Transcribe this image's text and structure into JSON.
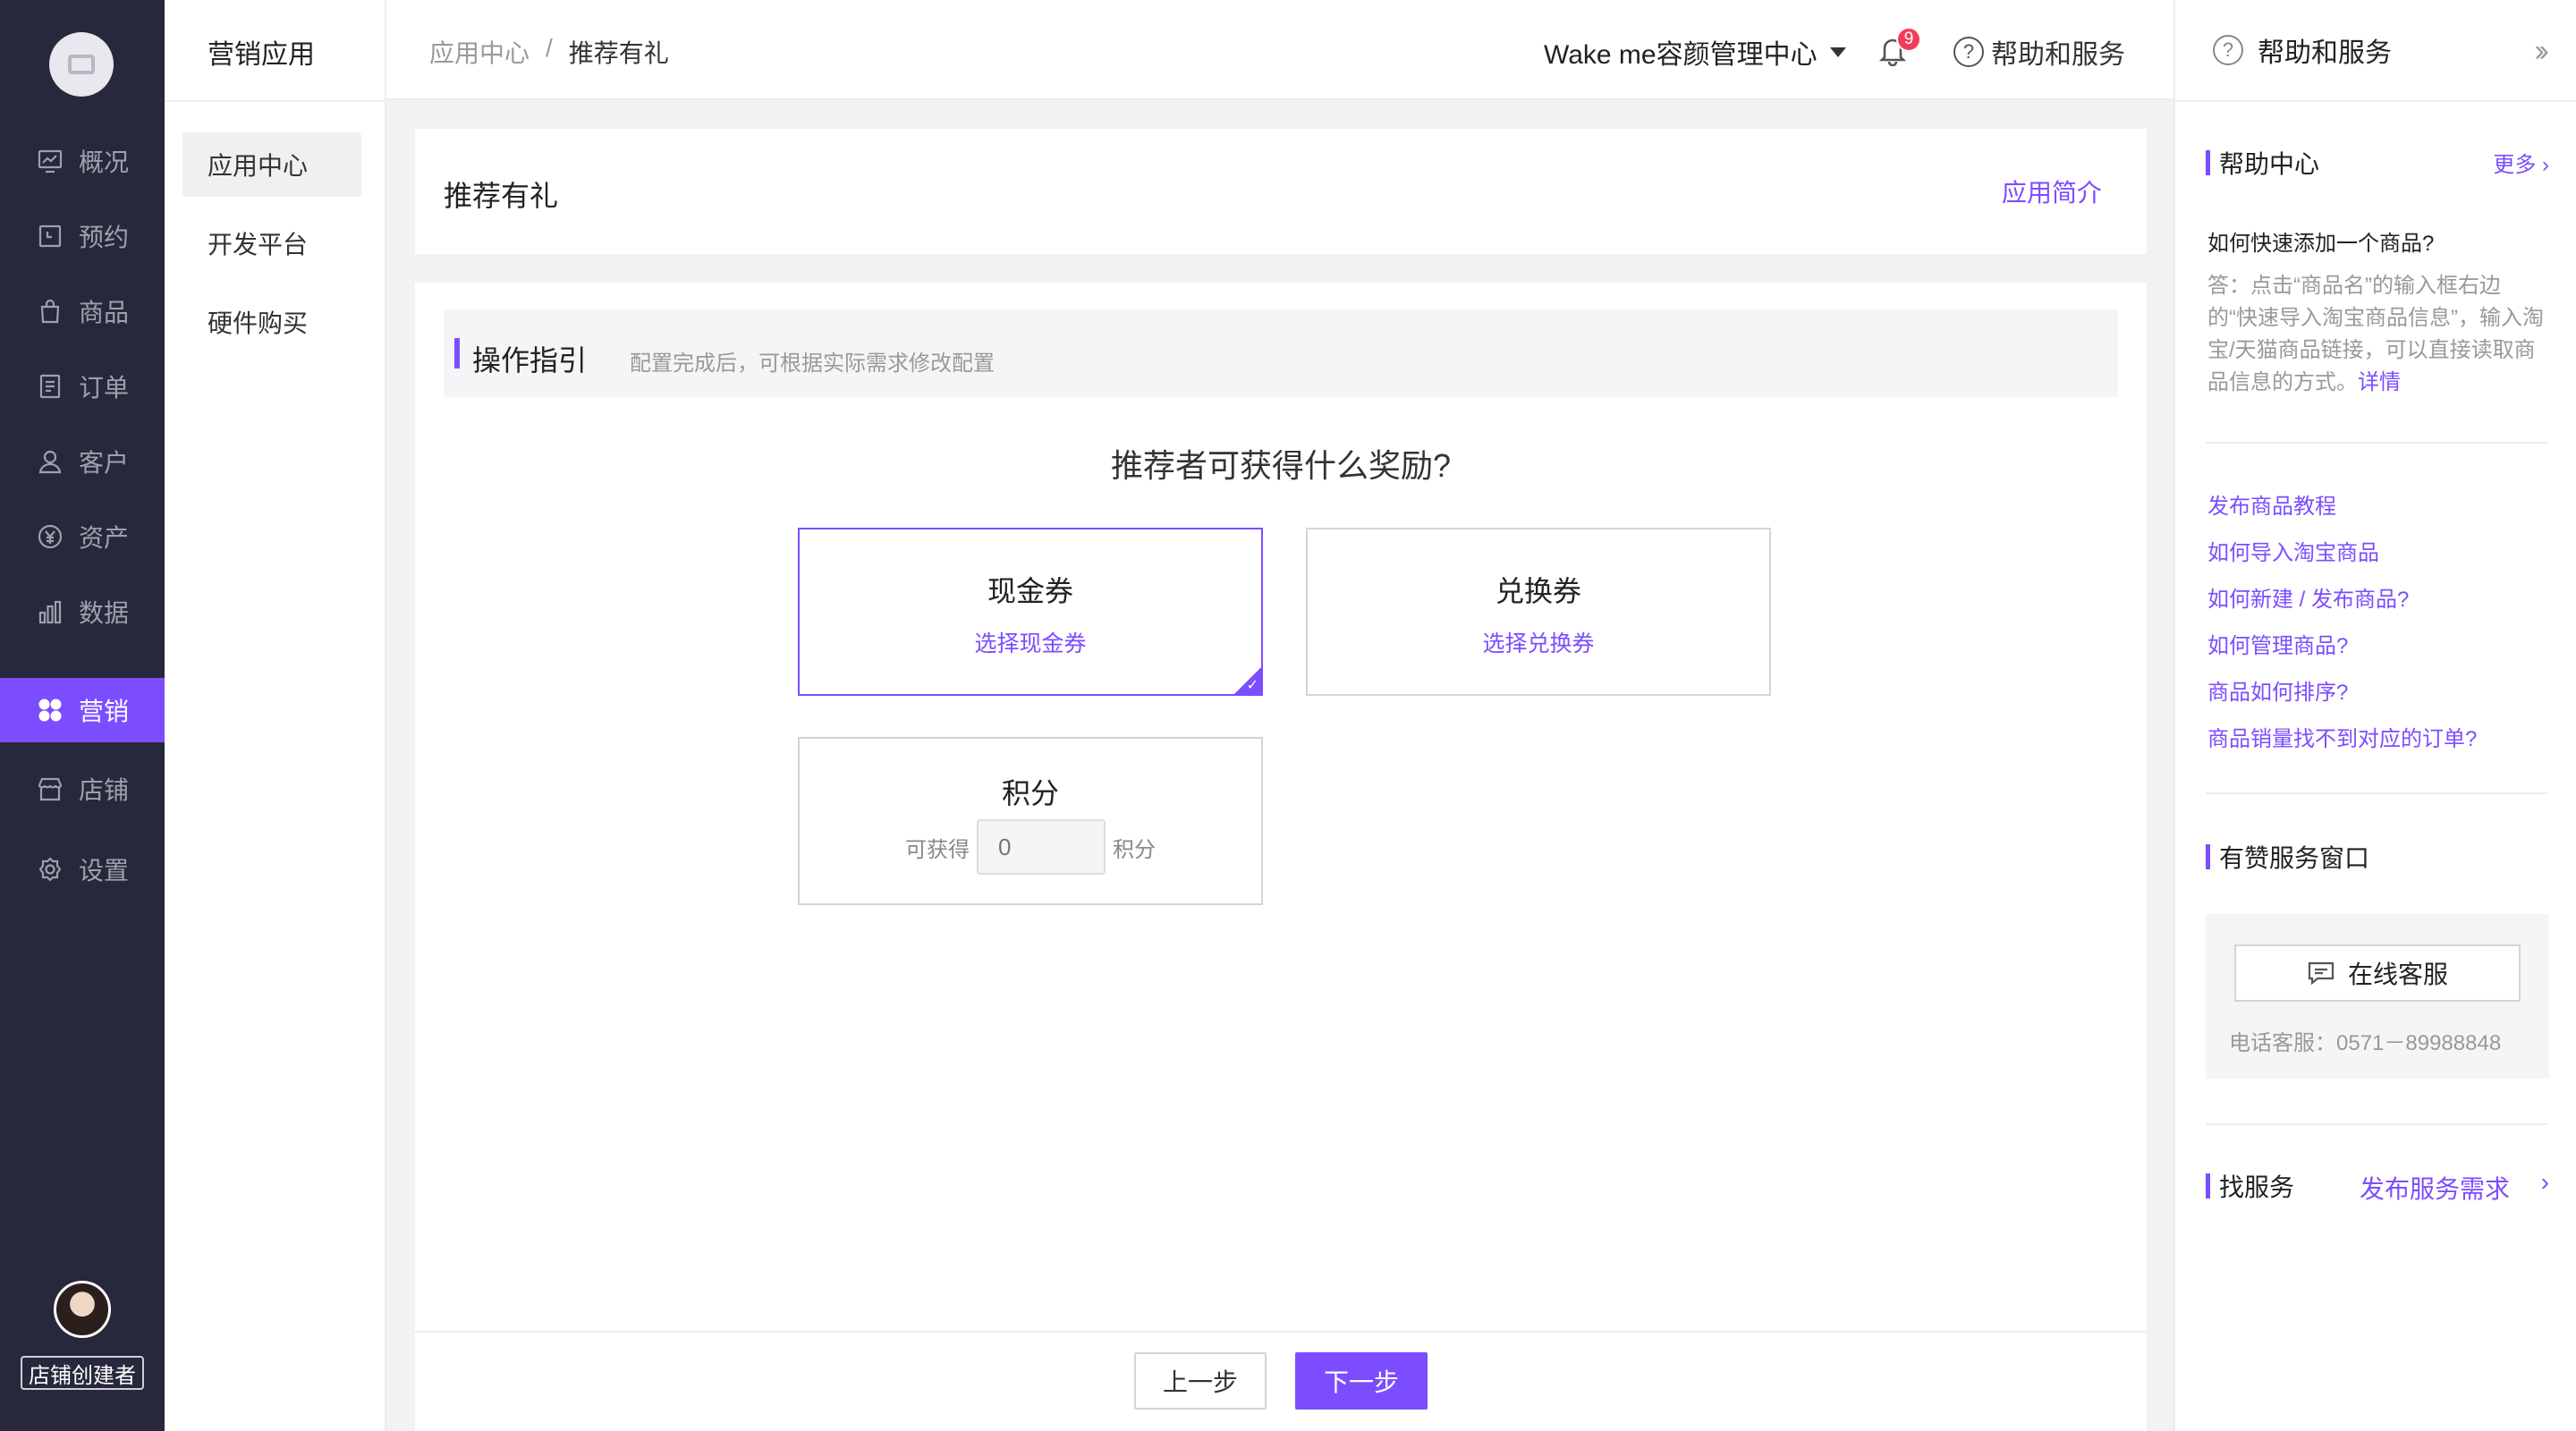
{
  "nav": {
    "items": [
      {
        "label": "概况",
        "icon": "overview-icon"
      },
      {
        "label": "预约",
        "icon": "calendar-icon"
      },
      {
        "label": "商品",
        "icon": "product-bag-icon"
      },
      {
        "label": "订单",
        "icon": "order-list-icon"
      },
      {
        "label": "客户",
        "icon": "user-icon"
      },
      {
        "label": "资产",
        "icon": "yuan-coin-icon"
      },
      {
        "label": "数据",
        "icon": "bar-chart-icon"
      },
      {
        "label": "营销",
        "icon": "marketing-grid-icon"
      },
      {
        "label": "店铺",
        "icon": "store-icon"
      },
      {
        "label": "设置",
        "icon": "gear-icon"
      }
    ],
    "active": "营销",
    "owner_badge": "店铺创建者"
  },
  "subnav": {
    "title": "营销应用",
    "items": [
      "应用中心",
      "开发平台",
      "硬件购买"
    ],
    "active": "应用中心"
  },
  "header": {
    "breadcrumb": [
      "应用中心",
      "/",
      "推荐有礼"
    ],
    "shop_name": "Wake me容颜管理中心",
    "notification_count": "9",
    "help_label": "帮助和服务"
  },
  "main": {
    "page_title": "推荐有礼",
    "intro_link": "应用简介",
    "guide_title": "操作指引",
    "guide_subtitle": "配置完成后，可根据实际需求修改配置",
    "question": "推荐者可获得什么奖励?",
    "options": {
      "cash": {
        "title": "现金券",
        "link": "选择现金券",
        "selected": true
      },
      "exchange": {
        "title": "兑换券",
        "link": "选择兑换券",
        "selected": false
      },
      "points": {
        "title": "积分",
        "prefix": "可获得",
        "placeholder": "0",
        "suffix": "积分"
      }
    },
    "prev_button": "上一步",
    "next_button": "下一步"
  },
  "help_panel": {
    "title": "帮助和服务",
    "help_center": {
      "title": "帮助中心",
      "more": "更多",
      "question": "如何快速添加一个商品?",
      "answer": "答：点击“商品名”的输入框右边的“快速导入淘宝商品信息”，输入淘宝/天猫商品链接，可以直接读取商品信息的方式。",
      "answer_link": "详情",
      "links": [
        "发布商品教程",
        "如何导入淘宝商品",
        "如何新建 / 发布商品?",
        "如何管理商品?",
        "商品如何排序?",
        "商品销量找不到对应的订单?"
      ]
    },
    "service_window": {
      "title": "有赞服务窗口",
      "online_button": "在线客服",
      "phone": "电话客服：0571－89988848"
    },
    "find_service": {
      "title": "找服务",
      "link": "发布服务需求"
    }
  },
  "colors": {
    "accent": "#7c4dff",
    "sidebar_bg": "#28283c",
    "badge": "#f23d5a"
  }
}
